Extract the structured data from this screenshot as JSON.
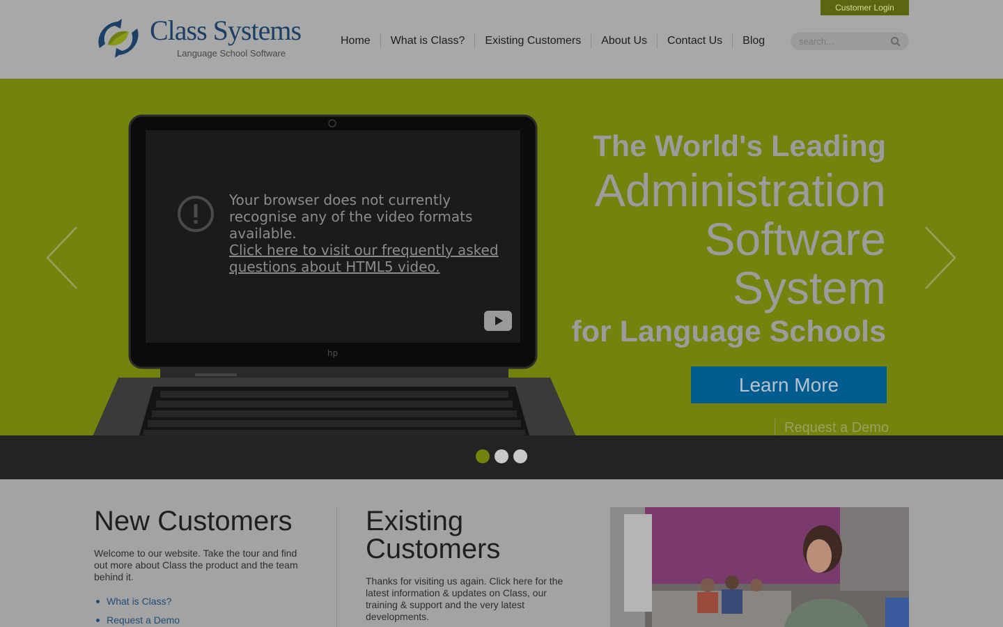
{
  "header": {
    "customer_login": "Customer Login",
    "logo_title": "Class Systems",
    "logo_subtitle": "Language School Software",
    "nav": [
      "Home",
      "What is Class?",
      "Existing Customers",
      "About Us",
      "Contact Us",
      "Blog"
    ],
    "search_placeholder": "search..."
  },
  "hero": {
    "video_message": "Your browser does not currently recognise any of the video formats available.",
    "video_link": "Click here to visit our frequently asked questions about HTML5 video.",
    "headline_top": "The World's Leading",
    "headline_main": "Administration Software System",
    "headline_bottom": "for Language Schools",
    "learn_more": "Learn More",
    "request_demo": "Request a Demo",
    "slides_total": 3,
    "active_slide": 1
  },
  "new_customers": {
    "title": "New Customers",
    "text": "Welcome to our website. Take the tour and find out more about Class the product and the team behind it.",
    "links": [
      "What is Class?",
      "Request a Demo"
    ]
  },
  "existing_customers": {
    "title": "Existing Customers",
    "text": "Thanks for visiting us again.  Click here for the latest information & updates on Class, our training & support and the very latest developments."
  },
  "colors": {
    "hero_green": "#73830d",
    "learn_blue": "#005b8e",
    "login_olive": "#5c6611",
    "dots_bar": "#232323"
  }
}
